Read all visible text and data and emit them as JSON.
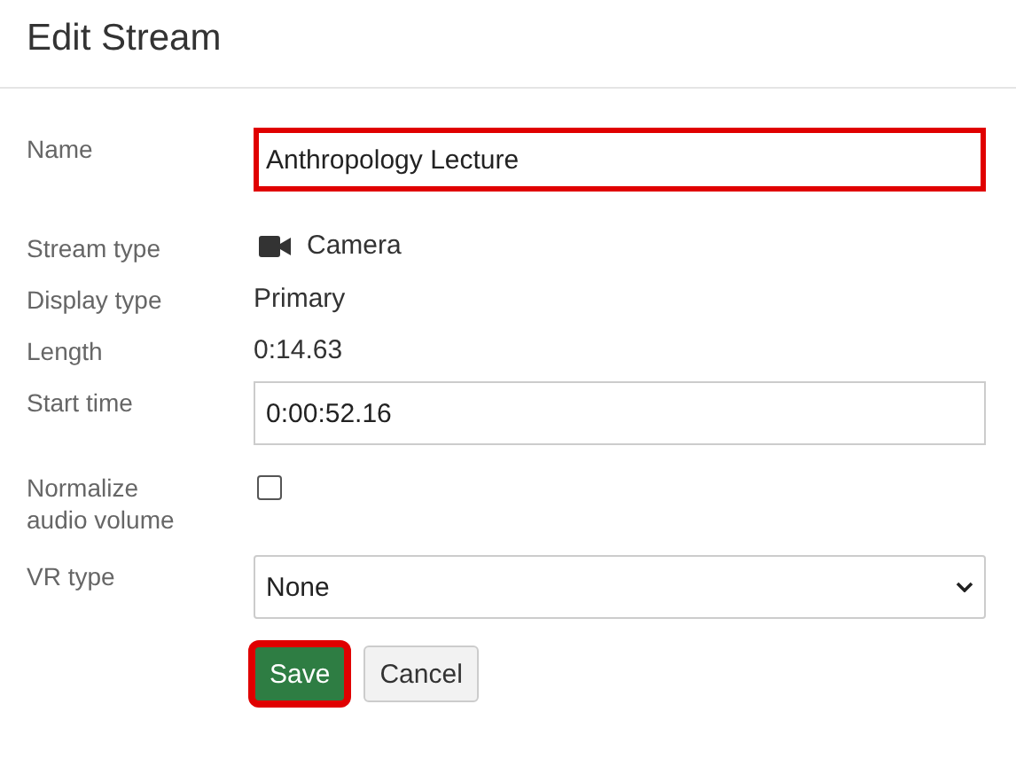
{
  "title": "Edit Stream",
  "fields": [
    {
      "kind": "input",
      "label": "Name",
      "value": "Anthropology Lecture",
      "highlighted": true
    },
    {
      "kind": "icon-text",
      "label": "Stream type",
      "value": "Camera"
    },
    {
      "kind": "text",
      "label": "Display type",
      "value": "Primary"
    },
    {
      "kind": "text",
      "label": "Length",
      "value": "0:14.63"
    },
    {
      "kind": "input",
      "label": "Start time",
      "value": "0:00:52.16",
      "highlighted": false
    },
    {
      "kind": "checkbox",
      "label": "Normalize audio volume",
      "checked": false
    },
    {
      "kind": "select",
      "label": "VR type",
      "value": "None"
    }
  ],
  "buttons": [
    {
      "kind": "primary",
      "label": "Save",
      "highlighted": true
    },
    {
      "kind": "secondary",
      "label": "Cancel",
      "highlighted": false
    }
  ]
}
